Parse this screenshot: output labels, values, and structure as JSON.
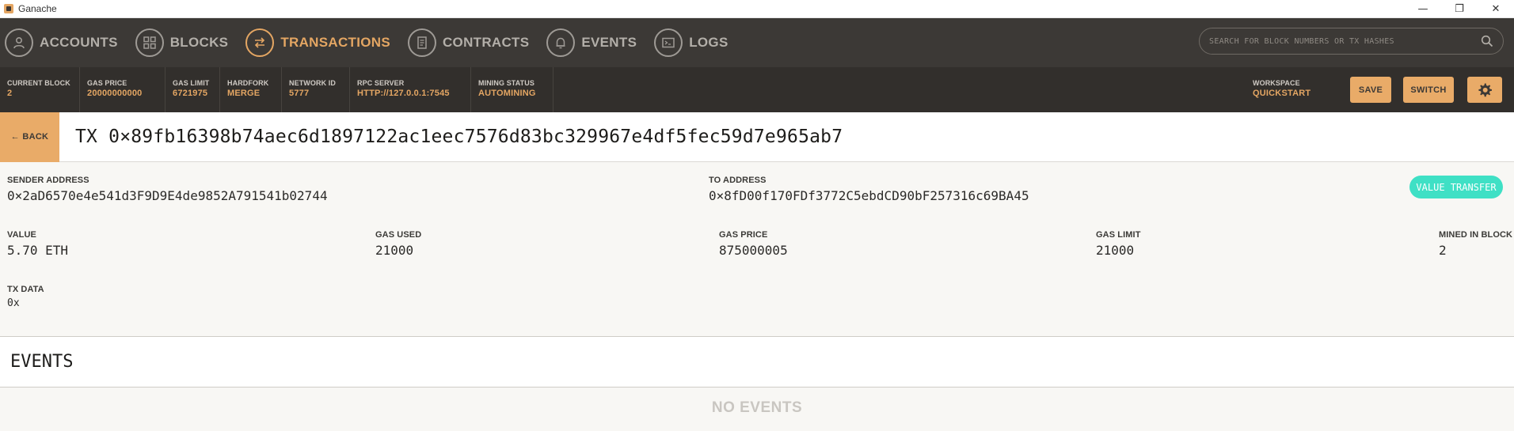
{
  "window": {
    "title": "Ganache"
  },
  "nav": {
    "items": [
      {
        "label": "ACCOUNTS",
        "icon": "account-icon"
      },
      {
        "label": "BLOCKS",
        "icon": "blocks-icon"
      },
      {
        "label": "TRANSACTIONS",
        "icon": "transactions-icon",
        "active": true
      },
      {
        "label": "CONTRACTS",
        "icon": "contracts-icon"
      },
      {
        "label": "EVENTS",
        "icon": "bell-icon"
      },
      {
        "label": "LOGS",
        "icon": "terminal-icon"
      }
    ],
    "search_placeholder": "SEARCH FOR BLOCK NUMBERS OR TX HASHES"
  },
  "status": {
    "current_block": {
      "label": "CURRENT BLOCK",
      "value": "2"
    },
    "gas_price": {
      "label": "GAS PRICE",
      "value": "20000000000"
    },
    "gas_limit": {
      "label": "GAS LIMIT",
      "value": "6721975"
    },
    "hardfork": {
      "label": "HARDFORK",
      "value": "MERGE"
    },
    "network_id": {
      "label": "NETWORK ID",
      "value": "5777"
    },
    "rpc_server": {
      "label": "RPC SERVER",
      "value": "HTTP://127.0.0.1:7545"
    },
    "mining_status": {
      "label": "MINING STATUS",
      "value": "AUTOMINING"
    },
    "workspace": {
      "label": "WORKSPACE",
      "value": "QUICKSTART"
    },
    "save_label": "SAVE",
    "switch_label": "SWITCH"
  },
  "tx": {
    "back_label": "← BACK",
    "title": "TX 0×89fb16398b74aec6d1897122ac1eec7576d83bc329967e4df5fec59d7e965ab7",
    "sender": {
      "label": "SENDER ADDRESS",
      "value": "0×2aD6570e4e541d3F9D9E4de9852A791541b02744"
    },
    "to": {
      "label": "TO ADDRESS",
      "value": "0×8fD00f170FDf3772C5ebdCD90bF257316c69BA45"
    },
    "badge": "VALUE TRANSFER",
    "value": {
      "label": "VALUE",
      "value": "5.70 ETH"
    },
    "gas_used": {
      "label": "GAS USED",
      "value": "21000"
    },
    "gas_price": {
      "label": "GAS PRICE",
      "value": "875000005"
    },
    "gas_limit": {
      "label": "GAS LIMIT",
      "value": "21000"
    },
    "mined_in_block": {
      "label": "MINED IN BLOCK",
      "value": "2"
    },
    "tx_data": {
      "label": "TX DATA",
      "value": "0x"
    }
  },
  "events": {
    "title": "EVENTS",
    "empty_label": "NO EVENTS"
  },
  "colors": {
    "accent": "#e4a663",
    "nav_bg": "#3c3936",
    "status_bg": "#322f2c",
    "badge": "#3fe0c5"
  }
}
